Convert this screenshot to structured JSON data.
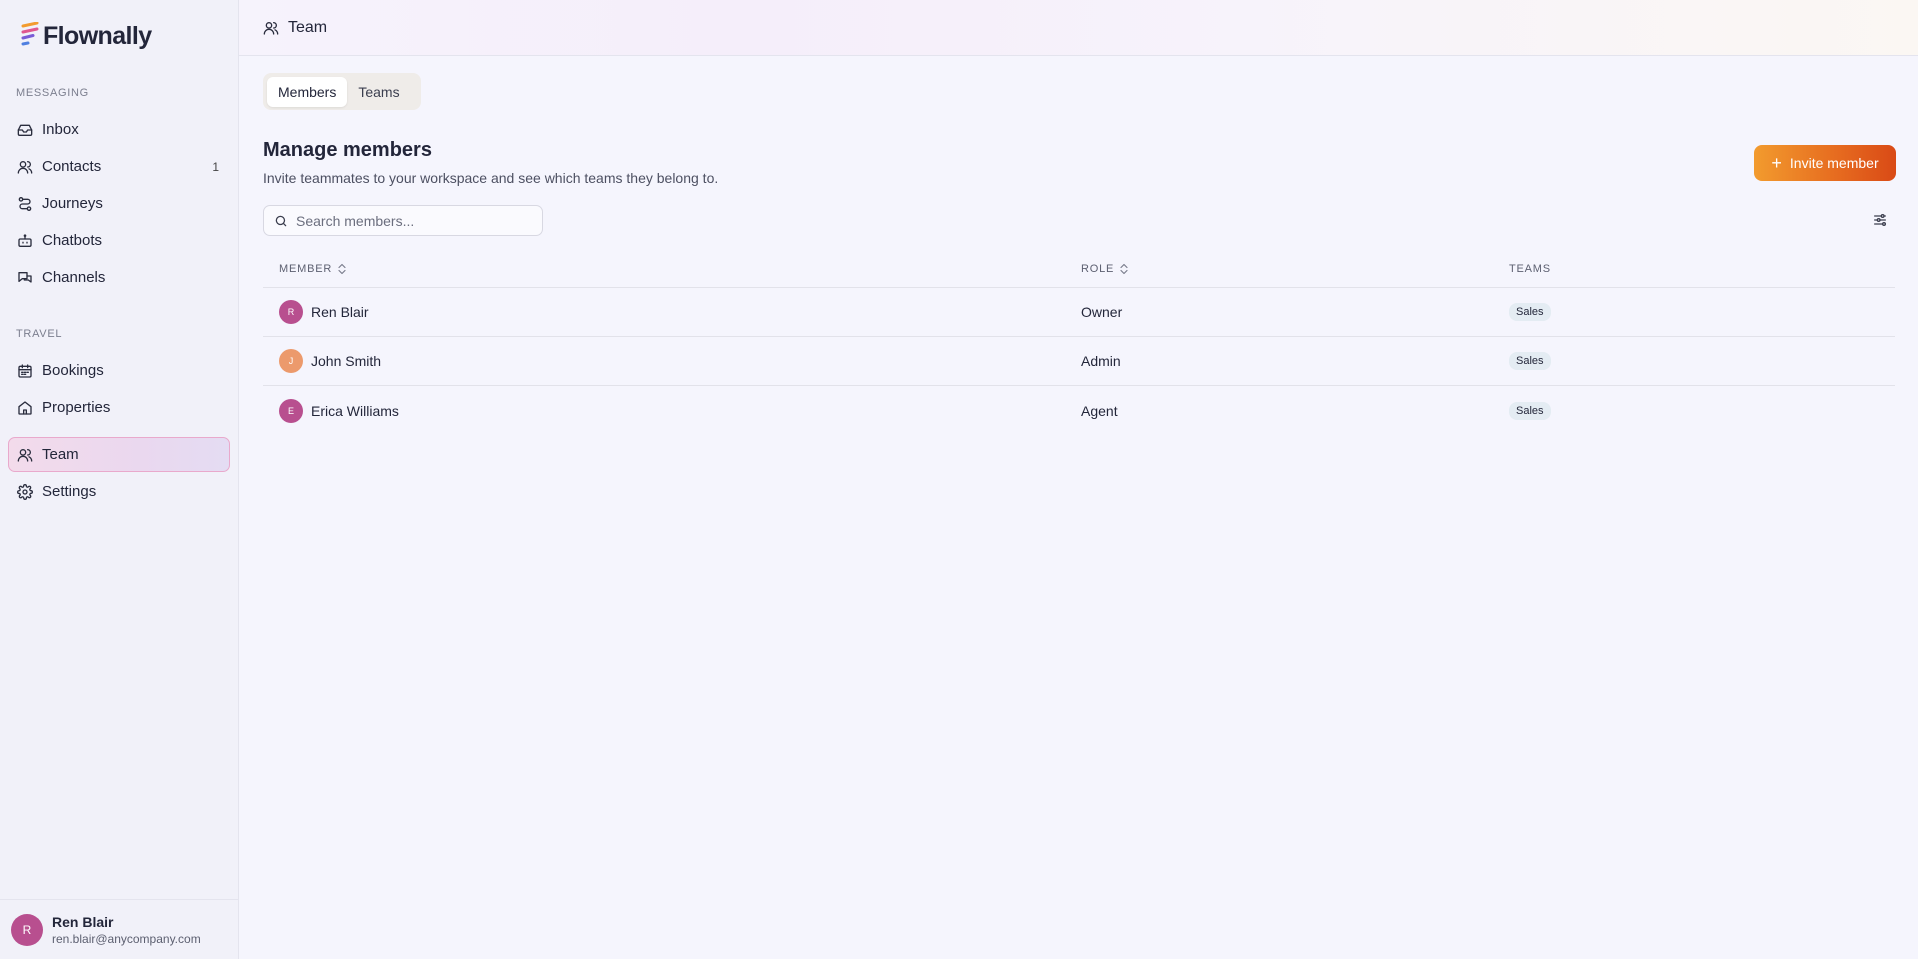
{
  "brand": {
    "name": "Flownally"
  },
  "sidebar": {
    "sections": [
      {
        "label": "MESSAGING"
      },
      {
        "label": "TRAVEL"
      }
    ],
    "items": [
      {
        "label": "Inbox",
        "icon": "inbox-icon"
      },
      {
        "label": "Contacts",
        "icon": "users-icon",
        "count": "1"
      },
      {
        "label": "Journeys",
        "icon": "journey-icon"
      },
      {
        "label": "Chatbots",
        "icon": "bot-icon"
      },
      {
        "label": "Channels",
        "icon": "chat-icon"
      },
      {
        "label": "Bookings",
        "icon": "calendar-icon"
      },
      {
        "label": "Properties",
        "icon": "home-icon"
      },
      {
        "label": "Team",
        "icon": "team-icon",
        "active": true
      },
      {
        "label": "Settings",
        "icon": "gear-icon"
      }
    ],
    "user": {
      "initial": "R",
      "name": "Ren Blair",
      "email": "ren.blair@anycompany.com"
    }
  },
  "topbar": {
    "title": "Team"
  },
  "tabs": [
    {
      "label": "Members",
      "active": true
    },
    {
      "label": "Teams",
      "active": false
    }
  ],
  "page": {
    "title": "Manage members",
    "subtitle": "Invite teammates to your workspace and see which teams they belong to.",
    "invite_label": "Invite member"
  },
  "search": {
    "placeholder": "Search members...",
    "value": ""
  },
  "table": {
    "columns": {
      "member": "MEMBER",
      "role": "ROLE",
      "teams": "TEAMS"
    },
    "rows": [
      {
        "initial": "R",
        "name": "Ren Blair",
        "role": "Owner",
        "team": "Sales",
        "avatar_color": "#b84f8f"
      },
      {
        "initial": "J",
        "name": "John Smith",
        "role": "Admin",
        "team": "Sales",
        "avatar_color": "#ec9a6c"
      },
      {
        "initial": "E",
        "name": "Erica Williams",
        "role": "Agent",
        "team": "Sales",
        "avatar_color": "#b84f8f"
      }
    ]
  },
  "colors": {
    "accent_orange": "#e66a1f",
    "active_border": "#e9a9cc",
    "avatar_pink": "#b84f8f"
  }
}
